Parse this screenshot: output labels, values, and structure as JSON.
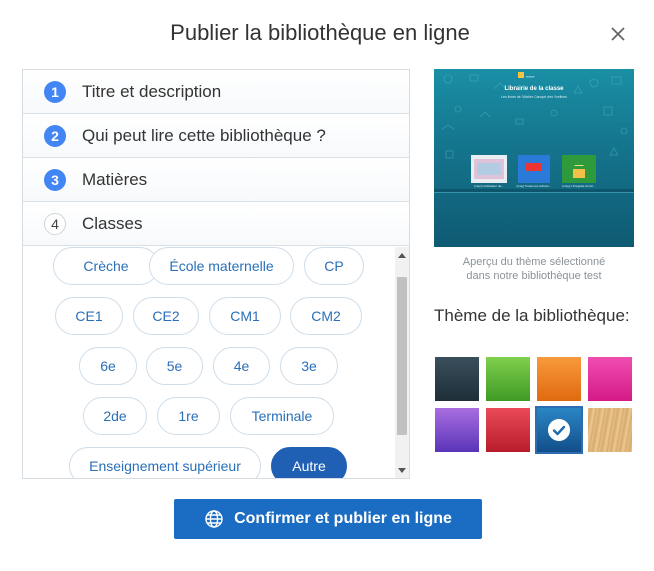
{
  "dialog": {
    "title": "Publier la bibliothèque en ligne"
  },
  "steps": [
    {
      "number": "1",
      "label": "Titre et description"
    },
    {
      "number": "2",
      "label": "Qui peut lire cette bibliothèque ?"
    },
    {
      "number": "3",
      "label": "Matières"
    },
    {
      "number": "4",
      "label": "Classes"
    }
  ],
  "classes": {
    "options": [
      "Crèche",
      "École maternelle",
      "CP",
      "CE1",
      "CE2",
      "CM1",
      "CM2",
      "6e",
      "5e",
      "4e",
      "3e",
      "2de",
      "1re",
      "Terminale",
      "Enseignement supérieur",
      "Autre"
    ],
    "selected": "Autre"
  },
  "preview": {
    "title": "Librairie de la classe",
    "subtitle": "Les livres de l'Atelier Canopé des Yvelines",
    "books": [
      "[may] l'ordinateur de...",
      "[may] Toutes les Actions...",
      "[may] L'intégrale du livr..."
    ],
    "caption_line1": "Aperçu du thème sélectionné",
    "caption_line2": "dans notre bibliothèque test"
  },
  "themes": {
    "label": "Thème de la bibliothèque:",
    "swatches": [
      {
        "name": "dark-slate",
        "color": "#2a3f4d",
        "selected": false
      },
      {
        "name": "green",
        "color": "#5fb53a",
        "selected": false
      },
      {
        "name": "orange",
        "color": "#f07e1c",
        "selected": false
      },
      {
        "name": "pink",
        "color": "#e8299a",
        "selected": false
      },
      {
        "name": "purple",
        "color": "#7a4cc8",
        "selected": false
      },
      {
        "name": "red",
        "color": "#d5283a",
        "selected": false
      },
      {
        "name": "teal-blue",
        "color": "#1a6ea6",
        "selected": true
      },
      {
        "name": "wood",
        "color": "#dfb57a",
        "selected": false
      }
    ]
  },
  "actions": {
    "confirm_label": "Confirmer et publier en ligne"
  },
  "colors": {
    "accent": "#1a6dc2",
    "step_badge": "#4285f4",
    "pill_text": "#2a6fb8"
  }
}
